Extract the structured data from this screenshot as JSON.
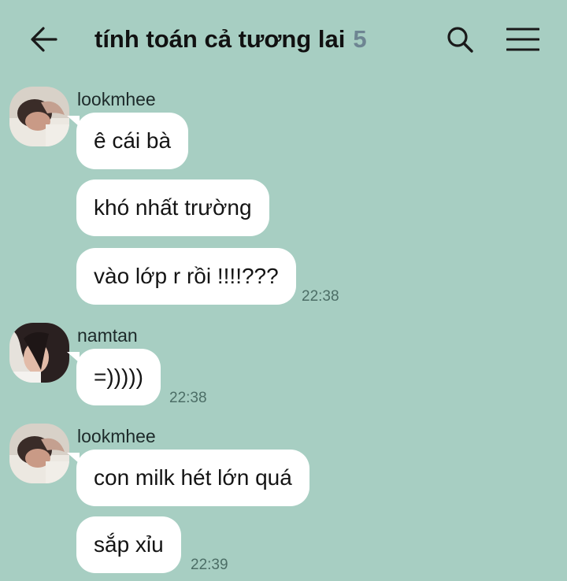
{
  "header": {
    "back_icon": "arrow-left-icon",
    "title": "tính toán cả tương lai",
    "member_count": "5",
    "search_icon": "search-icon",
    "menu_icon": "hamburger-menu-icon"
  },
  "messages": [
    {
      "sender": "lookmhee",
      "bubbles": [
        "ê cái bà",
        "khó nhất trường",
        "vào lớp r rồi !!!!???"
      ],
      "time": "22:38"
    },
    {
      "sender": "namtan",
      "bubbles": [
        "=)))))"
      ],
      "time": "22:38"
    },
    {
      "sender": "lookmhee",
      "bubbles": [
        "con milk hét lớn quá",
        "sắp xỉu"
      ],
      "time": "22:39"
    }
  ],
  "colors": {
    "background": "#a7cec2",
    "bubble": "#ffffff",
    "member_count": "#6e8592",
    "timestamp": "#4c6e66"
  }
}
